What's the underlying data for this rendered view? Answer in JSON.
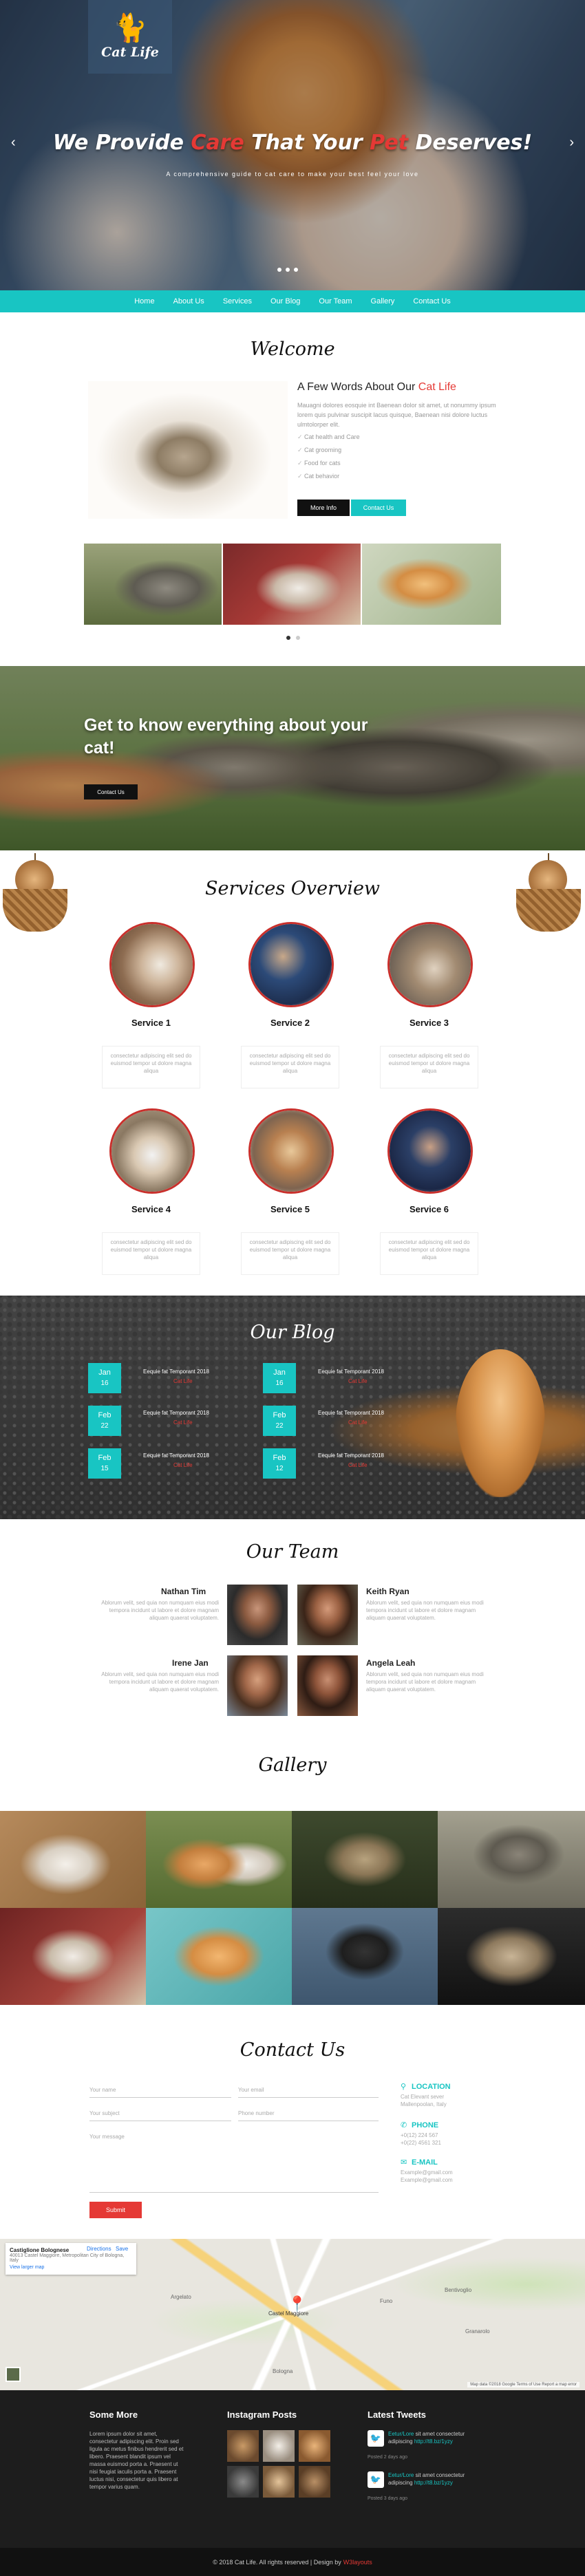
{
  "brand": {
    "name": "Cat Life"
  },
  "hero": {
    "title_pre": "We Provide ",
    "title_red1": "Care",
    "title_mid": " That Your ",
    "title_red2": "Pet",
    "title_post": " Deserves!",
    "subtitle": "A comprehensive guide to cat care to make your best feel your love",
    "prev": "‹",
    "next": "›"
  },
  "nav": {
    "items": [
      "Home",
      "About Us",
      "Services",
      "Our Blog",
      "Our Team",
      "Gallery",
      "Contact Us"
    ]
  },
  "welcome": {
    "title": "Welcome",
    "heading_pre": "A Few Words About Our ",
    "heading_accent": "Cat Life",
    "paragraph": "Mauagni dolores eosquie int Baenean dolor sit amet, ut nonummy ipsum lorem quis pulvinar suscipit lacus quisque, Baenean nisi dolore luctus ulmtolorper elit.",
    "list": [
      "Cat health and Care",
      "Cat grooming",
      "Food for cats",
      "Cat behavior"
    ],
    "more_label": "More Info",
    "contact_label": "Contact Us"
  },
  "know": {
    "title": "Get to know everything about your cat!",
    "button": "Contact Us"
  },
  "services": {
    "title": "Services Overview",
    "items": [
      {
        "name": "Service 1",
        "text": "consectetur adipiscing elit sed do euismod tempor ut dolore magna aliqua"
      },
      {
        "name": "Service 2",
        "text": "consectetur adipiscing elit sed do euismod tempor ut dolore magna aliqua"
      },
      {
        "name": "Service 3",
        "text": "consectetur adipiscing elit sed do euismod tempor ut dolore magna aliqua"
      },
      {
        "name": "Service 4",
        "text": "consectetur adipiscing elit sed do euismod tempor ut dolore magna aliqua"
      },
      {
        "name": "Service 5",
        "text": "consectetur adipiscing elit sed do euismod tempor ut dolore magna aliqua"
      },
      {
        "name": "Service 6",
        "text": "consectetur adipiscing elit sed do euismod tempor ut dolore magna aliqua"
      }
    ]
  },
  "blog": {
    "title": "Our Blog",
    "posts": [
      {
        "month": "Jan",
        "day": "16",
        "title": "Eequie fat Temporant 2018",
        "sub": "Cat Life"
      },
      {
        "month": "Jan",
        "day": "16",
        "title": "Eequie fat Temporant 2018",
        "sub": "Cat Life"
      },
      {
        "month": "Feb",
        "day": "22",
        "title": "Eequie fat Temporant 2018",
        "sub": "Cat Life"
      },
      {
        "month": "Feb",
        "day": "22",
        "title": "Eequie fat Temporant 2018",
        "sub": "Cat Life"
      },
      {
        "month": "Feb",
        "day": "15",
        "title": "Eequie fat Temporant 2018",
        "sub": "Cat Life"
      },
      {
        "month": "Feb",
        "day": "12",
        "title": "Eequie fat Temporant 2018",
        "sub": "Cat Life"
      }
    ]
  },
  "team": {
    "title": "Our Team",
    "members": [
      {
        "name": "Nathan Tim",
        "text": "Ablorum velit, sed quia non numquam eius modi tempora incidunt ut labore et dolore magnam aliquam quaerat voluptatem."
      },
      {
        "name": "Keith Ryan",
        "text": "Ablorum velit, sed quia non numquam eius modi tempora incidunt ut labore et dolore magnam aliquam quaerat voluptatem."
      },
      {
        "name": "Irene Jan",
        "text": "Ablorum velit, sed quia non numquam eius modi tempora incidunt ut labore et dolore magnam aliquam quaerat voluptatem."
      },
      {
        "name": "Angela Leah",
        "text": "Ablorum velit, sed quia non numquam eius modi tempora incidunt ut labore et dolore magnam aliquam quaerat voluptatem."
      }
    ]
  },
  "gallery": {
    "title": "Gallery"
  },
  "contact": {
    "title": "Contact Us",
    "name_ph": "Your name",
    "email_ph": "Your email",
    "subject_ph": "Your subject",
    "phone_ph": "Phone number",
    "message_ph": "Your message",
    "submit": "Submit",
    "location_label": "LOCATION",
    "location_text": "Cat Elevant sever Mallenpoolan, Italy",
    "phone_label": "PHONE",
    "phone_text": "+0(12) 224 567 +0(22) 4561 321",
    "email_label": "E-MAIL",
    "email_text": "Example@gmail.com Example@gmail.com"
  },
  "map": {
    "place": "Castiglione Bolognese",
    "address": "40013 Castel Maggiore, Metropolitan City of Bologna, Italy",
    "directions": "Directions",
    "save": "Save",
    "larger": "View larger map",
    "pin_label": "Castel Maggiore",
    "labels": [
      "Bologna",
      "Argelato",
      "Bentivoglio",
      "Funo",
      "Granarolo"
    ],
    "credit": "Map data ©2018 Google  Terms of Use  Report a map error"
  },
  "footer": {
    "col1_title": "Some More",
    "col1_text": "Lorem ipsum dolor sit amet, consectetur adipiscing elit. Proin sed ligula ac metus finibus hendrerit sed et libero. Praesent blandit ipsum vel massa euismod porta a. Praesent ut nisi feugiat iaculis porta a. Praesent luctus nisi, consectetur quis libero at tempor varius quam.",
    "col2_title": "Instagram Posts",
    "col3_title": "Latest Tweets",
    "tweets": [
      {
        "pre": "Eetur/Lore ",
        "mid": "sit amet consectetur adipiscing ",
        "link": "http://t8.bz/1yzy",
        "when": "Posted 2 days ago"
      },
      {
        "pre": "Eetur/Lore ",
        "mid": "sit amet consectetur adipiscing ",
        "link": "http://t8.bz/1yzy",
        "when": "Posted 3 days ago"
      }
    ],
    "copy_pre": "© 2018 Cat Life. All rights reserved | Design by",
    "copy_brand": "W3layouts"
  },
  "colors": {
    "accent": "#18c5c3",
    "red": "#e53935",
    "dark": "#1d1d1d"
  }
}
